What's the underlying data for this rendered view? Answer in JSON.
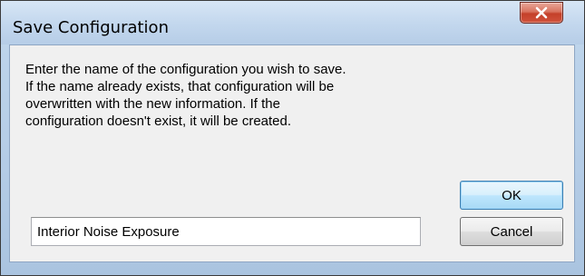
{
  "window": {
    "title": "Save Configuration",
    "close_label": "X"
  },
  "message": {
    "lines": [
      "Enter the name of the configuration you wish to save.",
      "If the name already exists, that configuration will be",
      "overwritten with the new information.  If the",
      "configuration doesn't exist, it will be created."
    ]
  },
  "form": {
    "name_value": "Interior Noise Exposure"
  },
  "buttons": {
    "ok_label": "OK",
    "cancel_label": "Cancel"
  },
  "icons": {
    "close": "close-icon"
  },
  "colors": {
    "close_button": "#c4402a",
    "ok_border": "#3c7fb1",
    "window_frame": "#b4cce6"
  }
}
